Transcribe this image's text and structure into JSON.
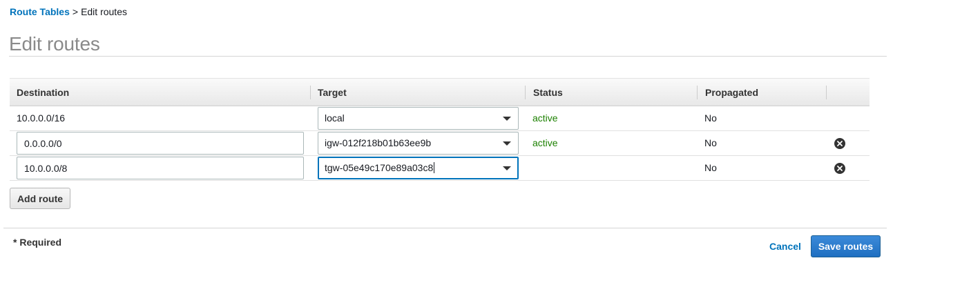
{
  "breadcrumb": {
    "parent": "Route Tables",
    "separator": ">",
    "current": "Edit routes"
  },
  "page": {
    "title": "Edit routes"
  },
  "table": {
    "headers": {
      "destination": "Destination",
      "target": "Target",
      "status": "Status",
      "propagated": "Propagated"
    },
    "rows": [
      {
        "destination": "10.0.0.0/16",
        "target": "local",
        "status": "active",
        "propagated": "No"
      },
      {
        "destination": "0.0.0.0/0",
        "target": "igw-012f218b01b63ee9b",
        "status": "active",
        "propagated": "No"
      },
      {
        "destination": "10.0.0.0/8",
        "target": "tgw-05e49c170e89a03c8",
        "status": "",
        "propagated": "No"
      }
    ]
  },
  "actions": {
    "add_route": "Add route",
    "cancel": "Cancel",
    "save_routes": "Save routes"
  },
  "footer": {
    "required_note": "* Required"
  },
  "colors": {
    "link": "#0073bb",
    "status_active": "#1d8102",
    "primary_button": "#1f6fc1"
  },
  "icons": {
    "remove": "remove-circle-x-icon",
    "dropdown": "caret-down-icon"
  }
}
